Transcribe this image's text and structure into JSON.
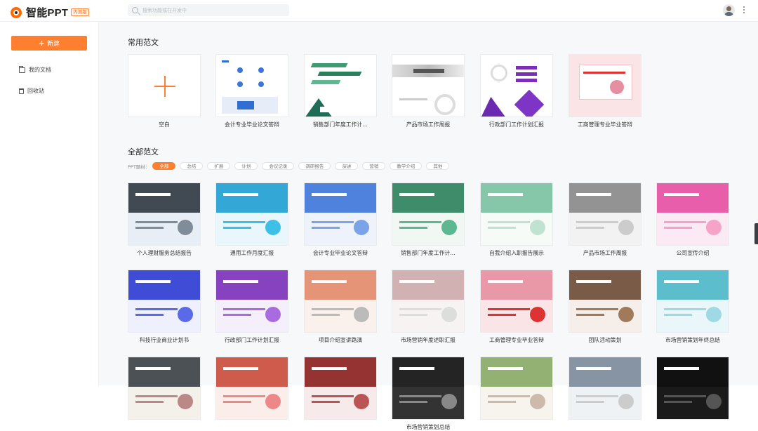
{
  "app": {
    "name": "智能PPT",
    "badge": "内测版"
  },
  "search": {
    "placeholder": "搜索功能或在开发中"
  },
  "sidebar": {
    "new_label": "新建",
    "items": [
      {
        "label": "我的文档"
      },
      {
        "label": "回收站"
      }
    ]
  },
  "sections": {
    "common": "常用范文",
    "all": "全部范文"
  },
  "filter": {
    "label": "PPT题材：",
    "tags": [
      "全部",
      "总结",
      "扩展",
      "计划",
      "会议记录",
      "调研报告",
      "演讲",
      "营销",
      "教学介绍",
      "其他"
    ]
  },
  "common_cards": [
    "空白",
    "会计专业毕业论文答辩",
    "销售部门年度工作计…",
    "产品市场工作周报",
    "行政部门工作计划汇报",
    "工商管理专业毕业答辩"
  ],
  "grid_rows": [
    [
      "个人理财服务总结报告",
      "通用工作月度汇报",
      "会计专业毕业论文答辩",
      "销售部门年度工作计…",
      "自我介绍入职报告展示",
      "产品市场工作周报",
      "公司宣传介绍"
    ],
    [
      "科技行业商业计划书",
      "行政部门工作计划汇报",
      "项目介绍宣讲路演",
      "市场营销年度述职汇报",
      "工商管理专业毕业答辩",
      "团队活动策划",
      "市场营销策划年终总结"
    ],
    [
      "",
      "",
      "",
      "市场营销策划总结",
      "",
      "",
      ""
    ]
  ],
  "colors": {
    "accent": "#ff7f30"
  }
}
